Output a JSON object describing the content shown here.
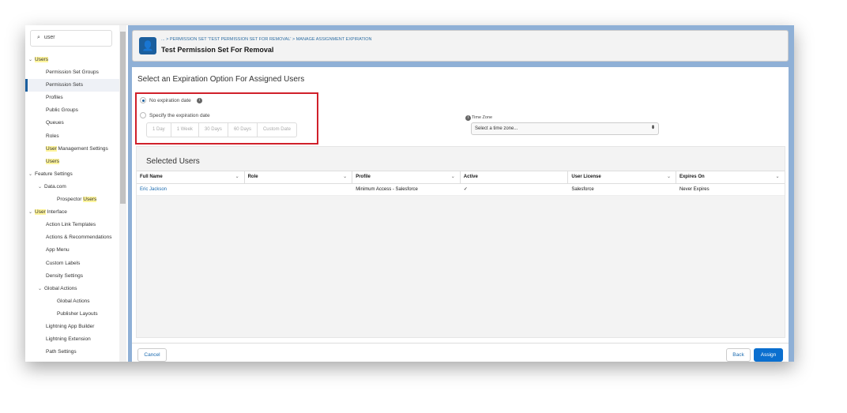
{
  "sidebar": {
    "search_value": "user",
    "items": [
      {
        "label": "Users",
        "level": 0,
        "chevron": true
      },
      {
        "label": "Permission Set Groups",
        "level": 1
      },
      {
        "label": "Permission Sets",
        "level": 1,
        "selected": true
      },
      {
        "label": "Profiles",
        "level": 1
      },
      {
        "label": "Public Groups",
        "level": 1
      },
      {
        "label": "Queues",
        "level": 1
      },
      {
        "label": "Roles",
        "level": 1
      },
      {
        "label": "User Management Settings",
        "level": 1
      },
      {
        "label": "Users",
        "level": 1
      },
      {
        "label": "Feature Settings",
        "level": 0,
        "chevron": true
      },
      {
        "label": "Data.com",
        "level": 1,
        "chevron": true
      },
      {
        "label": "Prospector Users",
        "level": 2
      },
      {
        "label": "User Interface",
        "level": 0,
        "chevron": true
      },
      {
        "label": "Action Link Templates",
        "level": 1
      },
      {
        "label": "Actions & Recommendations",
        "level": 1
      },
      {
        "label": "App Menu",
        "level": 1
      },
      {
        "label": "Custom Labels",
        "level": 1
      },
      {
        "label": "Density Settings",
        "level": 1
      },
      {
        "label": "Global Actions",
        "level": 1,
        "chevron": true
      },
      {
        "label": "Global Actions",
        "level": 2
      },
      {
        "label": "Publisher Layouts",
        "level": 2
      },
      {
        "label": "Lightning App Builder",
        "level": 1
      },
      {
        "label": "Lightning Extension",
        "level": 1
      },
      {
        "label": "Path Settings",
        "level": 1
      }
    ]
  },
  "header": {
    "breadcrumb": "... > PERMISSION SET 'TEST PERMISSION SET FOR REMOVAL' > MANAGE ASSIGNMENT EXPIRATION",
    "title": "Test Permission Set For Removal"
  },
  "expiration": {
    "heading": "Select an Expiration Option For Assigned Users",
    "option_none": "No expiration date",
    "option_specify": "Specify the expiration date",
    "selected": "none",
    "durations": [
      "1 Day",
      "1 Week",
      "30 Days",
      "60 Days",
      "Custom Date"
    ],
    "timezone_label": "Time Zone",
    "timezone_placeholder": "Select a time zone..."
  },
  "selected_users": {
    "title": "Selected Users",
    "columns": [
      "Full Name",
      "Role",
      "Profile",
      "Active",
      "User License",
      "Expires On"
    ],
    "rows": [
      {
        "full_name": "Eric Jackson",
        "role": "",
        "profile": "Minimum Access - Salesforce",
        "active": "✓",
        "license": "Salesforce",
        "expires": "Never Expires"
      }
    ]
  },
  "footer": {
    "cancel": "Cancel",
    "back": "Back",
    "assign": "Assign"
  },
  "colors": {
    "accent": "#0b6fcf",
    "highlight_box": "#d0202a",
    "brand": "#1b5f9e"
  }
}
